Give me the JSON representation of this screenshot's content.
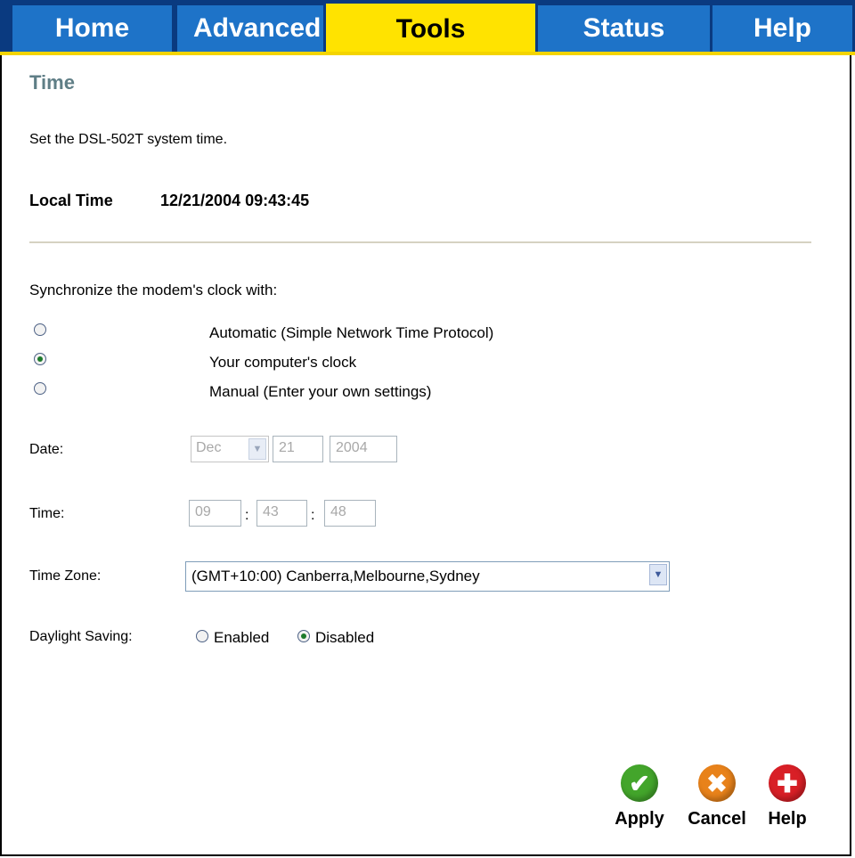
{
  "nav": {
    "tabs": [
      {
        "label": "Home"
      },
      {
        "label": "Advanced"
      },
      {
        "label": "Tools"
      },
      {
        "label": "Status"
      },
      {
        "label": "Help"
      }
    ],
    "active": "Tools"
  },
  "page": {
    "title": "Time",
    "intro": "Set the DSL-502T system time.",
    "local_time_label": "Local Time",
    "local_time_value": "12/21/2004 09:43:45"
  },
  "sync": {
    "heading": "Synchronize the modem's clock with:",
    "options": [
      {
        "label": "Automatic (Simple Network Time Protocol)",
        "checked": false
      },
      {
        "label": "Your computer's clock",
        "checked": true
      },
      {
        "label": "Manual (Enter your own settings)",
        "checked": false
      }
    ]
  },
  "date": {
    "label": "Date:",
    "month": "Dec",
    "day": "21",
    "year": "2004"
  },
  "time": {
    "label": "Time:",
    "hour": "09",
    "minute": "43",
    "second": "48",
    "separator": ":"
  },
  "timezone": {
    "label": "Time Zone:",
    "selected": "(GMT+10:00) Canberra,Melbourne,Sydney"
  },
  "daylight": {
    "label": "Daylight Saving:",
    "enabled_label": "Enabled",
    "disabled_label": "Disabled",
    "value": "Disabled"
  },
  "actions": {
    "apply": "Apply",
    "cancel": "Cancel",
    "help": "Help"
  },
  "colors": {
    "nav_bg": "#0a3a80",
    "tab_bg": "#1e73c8",
    "active_tab_bg": "#ffe300",
    "title_color": "#5f7e86",
    "apply": "#43a52b",
    "cancel": "#e8821a",
    "help": "#d81f26"
  }
}
